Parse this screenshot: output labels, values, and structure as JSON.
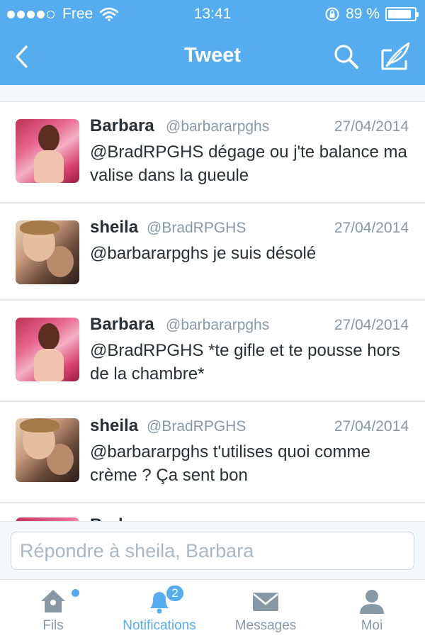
{
  "status_bar": {
    "carrier": "Free",
    "time": "13:41",
    "battery_percent": "89 %",
    "battery_level": 0.89,
    "signal_bars": 4
  },
  "nav": {
    "title": "Tweet"
  },
  "tweets": [
    {
      "name": "Barbara",
      "handle": "@barbararpghs",
      "date": "27/04/2014",
      "text": "@BradRPGHS dégage ou j'te balance ma valise dans la gueule",
      "avatar": "barbara-avatar"
    },
    {
      "name": "sheila",
      "handle": "@BradRPGHS",
      "date": "27/04/2014",
      "text": "@barbararpghs je suis désolé",
      "avatar": "sheila-avatar"
    },
    {
      "name": "Barbara",
      "handle": "@barbararpghs",
      "date": "27/04/2014",
      "text": "@BradRPGHS *te gifle et te pousse hors de la chambre*",
      "avatar": "barbara-avatar"
    },
    {
      "name": "sheila",
      "handle": "@BradRPGHS",
      "date": "27/04/2014",
      "text": "@barbararpghs t'utilises quoi comme crème ? Ça sent bon",
      "avatar": "sheila-avatar"
    },
    {
      "name": "Barbara",
      "handle": "",
      "date": "",
      "text": "",
      "avatar": "barbara-avatar"
    }
  ],
  "reply": {
    "placeholder": "Répondre à sheila, Barbara"
  },
  "tabs": {
    "home": {
      "label": "Fils",
      "has_dot": true
    },
    "notifications": {
      "label": "Notifications",
      "badge": "2"
    },
    "messages": {
      "label": "Messages"
    },
    "me": {
      "label": "Moi"
    }
  },
  "colors": {
    "brand": "#55acee",
    "text": "#292f33",
    "muted": "#8899a6",
    "background": "#f5f8fa"
  }
}
